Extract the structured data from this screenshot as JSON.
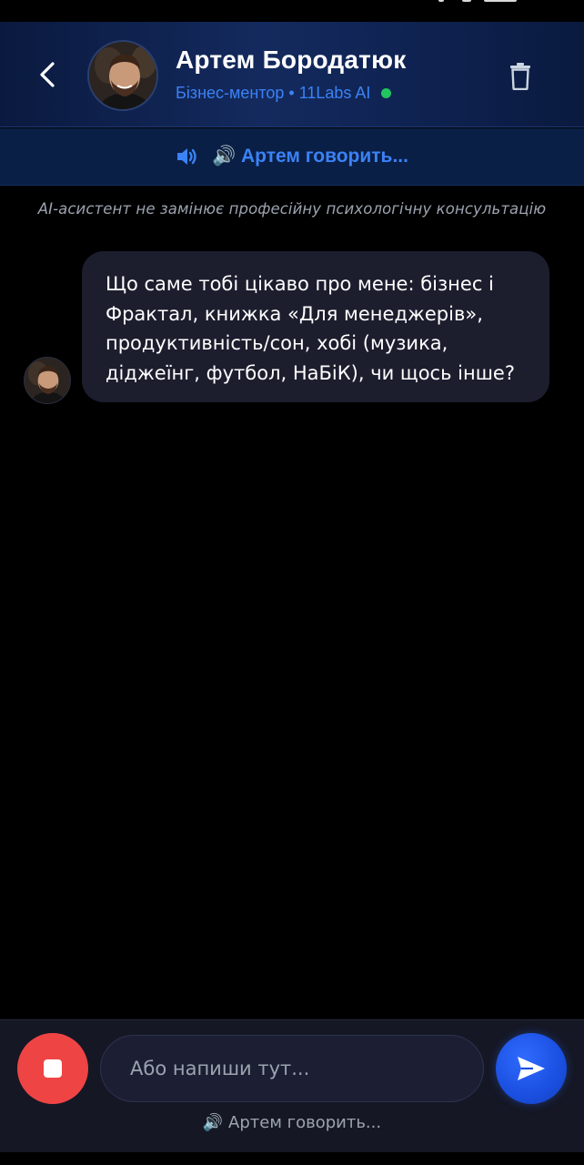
{
  "header": {
    "name": "Артем Бородатюк",
    "subtitle": "Бізнес-ментор • 11Labs AI",
    "status_color": "#22c55e",
    "icons": {
      "back": "chevron-left-icon",
      "delete": "trash-icon"
    }
  },
  "speaking_banner": {
    "text": "🔊 Артем говорить...",
    "icon": "volume-icon"
  },
  "disclaimer": "AI-асистент не замінює професійну психологічну консультацію",
  "messages": [
    {
      "sender": "assistant",
      "lines": [
        "Що саме тобі цікаво про мене: бізнес і",
        "Фрактал, книжка «Для менеджерів»,",
        "продуктивність/сон, хобі (музика,",
        "діджеїнг, футбол, НаБіК), чи щось інше?"
      ]
    }
  ],
  "composer": {
    "placeholder": "Або напиши тут...",
    "value": "",
    "status_text": "🔊 Артем говорить...",
    "stop_color": "#ef4444",
    "send_color": "#1a4fe0"
  },
  "colors": {
    "accent": "#3b82f6",
    "background": "#000000",
    "bubble": "#1c1e2e"
  }
}
